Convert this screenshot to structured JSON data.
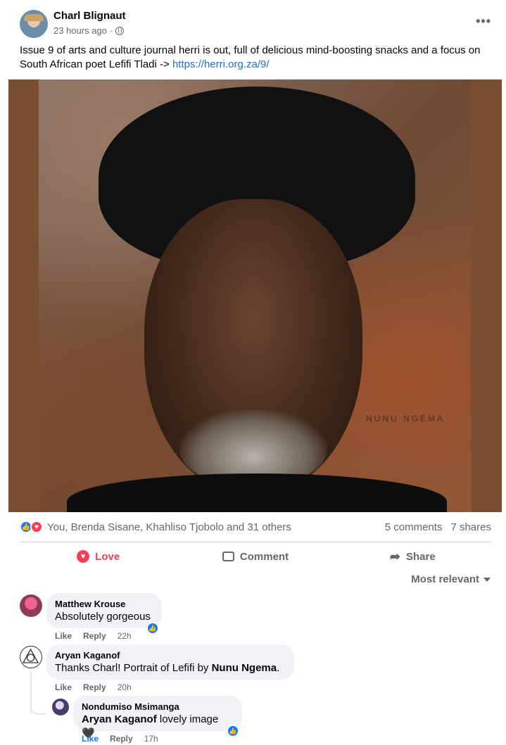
{
  "post": {
    "author": "Charl Blignaut",
    "time": "23 hours ago",
    "dot": "·",
    "more": "•••",
    "text": "Issue 9 of arts and culture journal herri is out, full of delicious mind-boosting snacks and a focus on South African poet Lefifi Tladi -> ",
    "link": "https://herri.org.za/9/",
    "photo_watermark": "NUNU NGEMA"
  },
  "reactions": {
    "icons": [
      "like-icon",
      "love-icon"
    ],
    "summary": "You, Brenda Sisane, Khahliso Tjobolo and 31 others",
    "comments": "5 comments",
    "shares": "7 shares"
  },
  "actions": {
    "love": "Love",
    "comment": "Comment",
    "share": "Share"
  },
  "sort": "Most relevant",
  "comments": [
    {
      "name": "Matthew Krouse",
      "text": "Absolutely gorgeous",
      "like": "Like",
      "reply": "Reply",
      "time": "22h"
    },
    {
      "name": "Aryan Kaganof",
      "text_before": "Thanks Charl! Portrait of Lefifi by ",
      "mention": "Nunu Ngema",
      "text_after": ".",
      "like": "Like",
      "reply": "Reply",
      "time": "20h"
    },
    {
      "name": "Nondumiso Msimanga",
      "mention": "Aryan Kaganof",
      "text": " lovely image 🖤",
      "like": "Like",
      "reply": "Reply",
      "time": "17h"
    }
  ],
  "colors": {
    "like_blue": "#1877f2",
    "love_red": "#f33e58",
    "link": "#216fdb",
    "muted": "#65676b"
  }
}
